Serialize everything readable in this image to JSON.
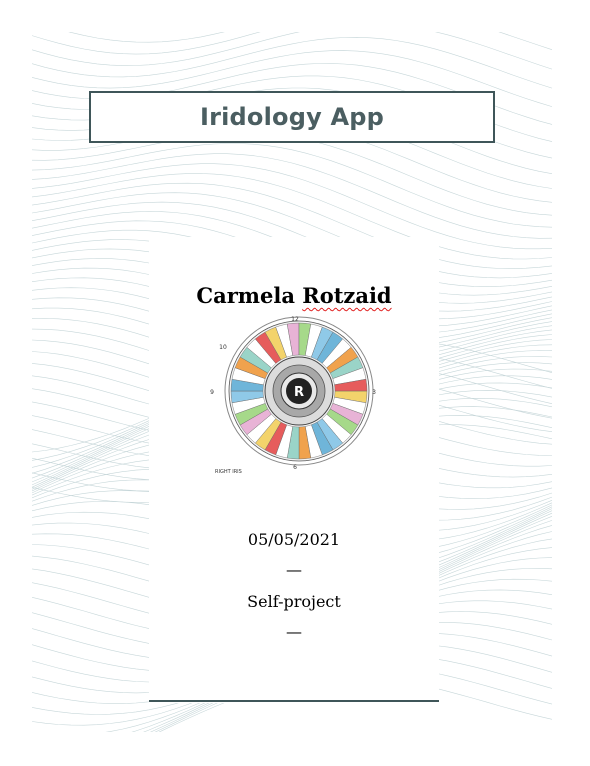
{
  "title": "Iridology App",
  "author": {
    "first_name": "Carmela",
    "last_name": "Rotzaid"
  },
  "image": {
    "center_letter": "R",
    "caption": "RIGHT IRIS",
    "numbers": [
      "12",
      "3",
      "6",
      "9",
      "10"
    ]
  },
  "date": "05/05/2021",
  "separator": "—",
  "project_type": "Self-project",
  "colors": {
    "border": "#3f5659",
    "title": "#4b5e61",
    "background_lines": "#b9cdd0"
  }
}
